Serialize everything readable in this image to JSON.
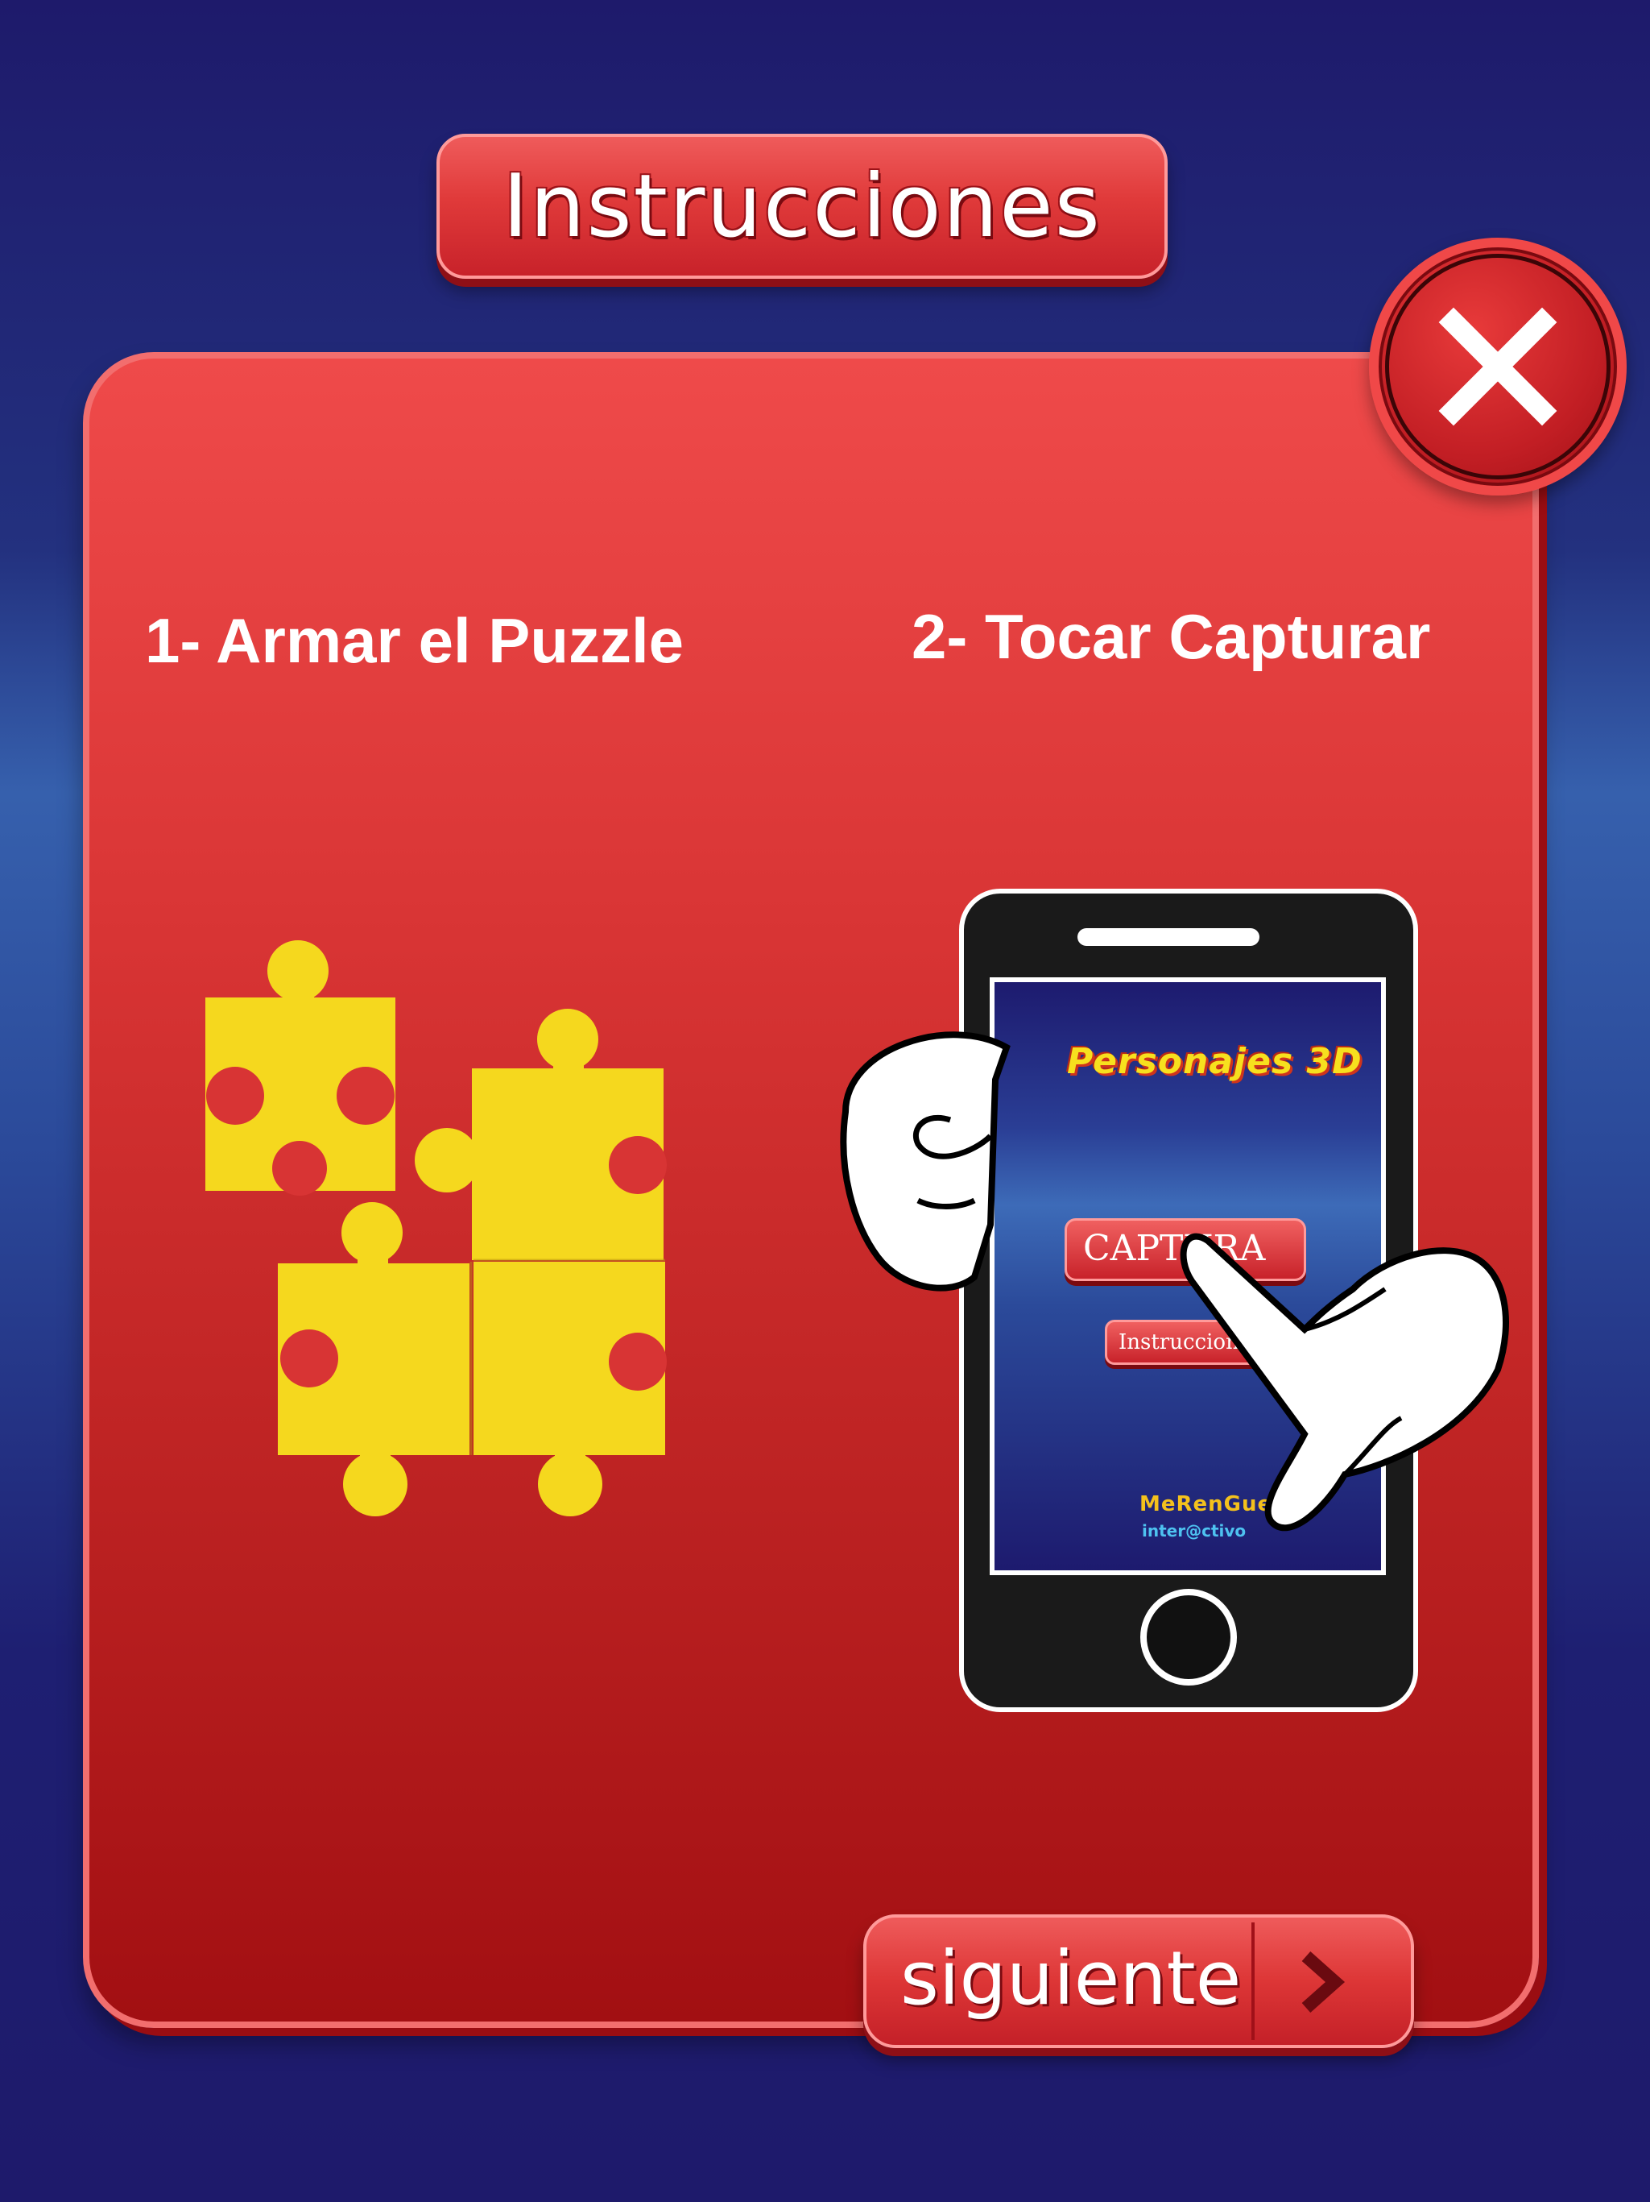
{
  "header": {
    "title": "Instrucciones"
  },
  "steps": [
    {
      "label": "1- Armar el Puzzle"
    },
    {
      "label": "2- Tocar Capturar"
    }
  ],
  "phone_screen": {
    "app_title": "Personajes 3D",
    "capture_button": "CAPTURA",
    "instructions_button": "Instrucciones",
    "brand_top": "MeRenGue",
    "brand_bottom": "inter@ctivo"
  },
  "footer": {
    "next_label": "siguiente"
  },
  "icons": {
    "close": "close-icon",
    "next": "chevron-right-icon"
  },
  "colors": {
    "background": "#1e1a6b",
    "panel": "#d83434",
    "puzzle": "#f5d81e",
    "phone_frame": "#1a1a1a"
  }
}
